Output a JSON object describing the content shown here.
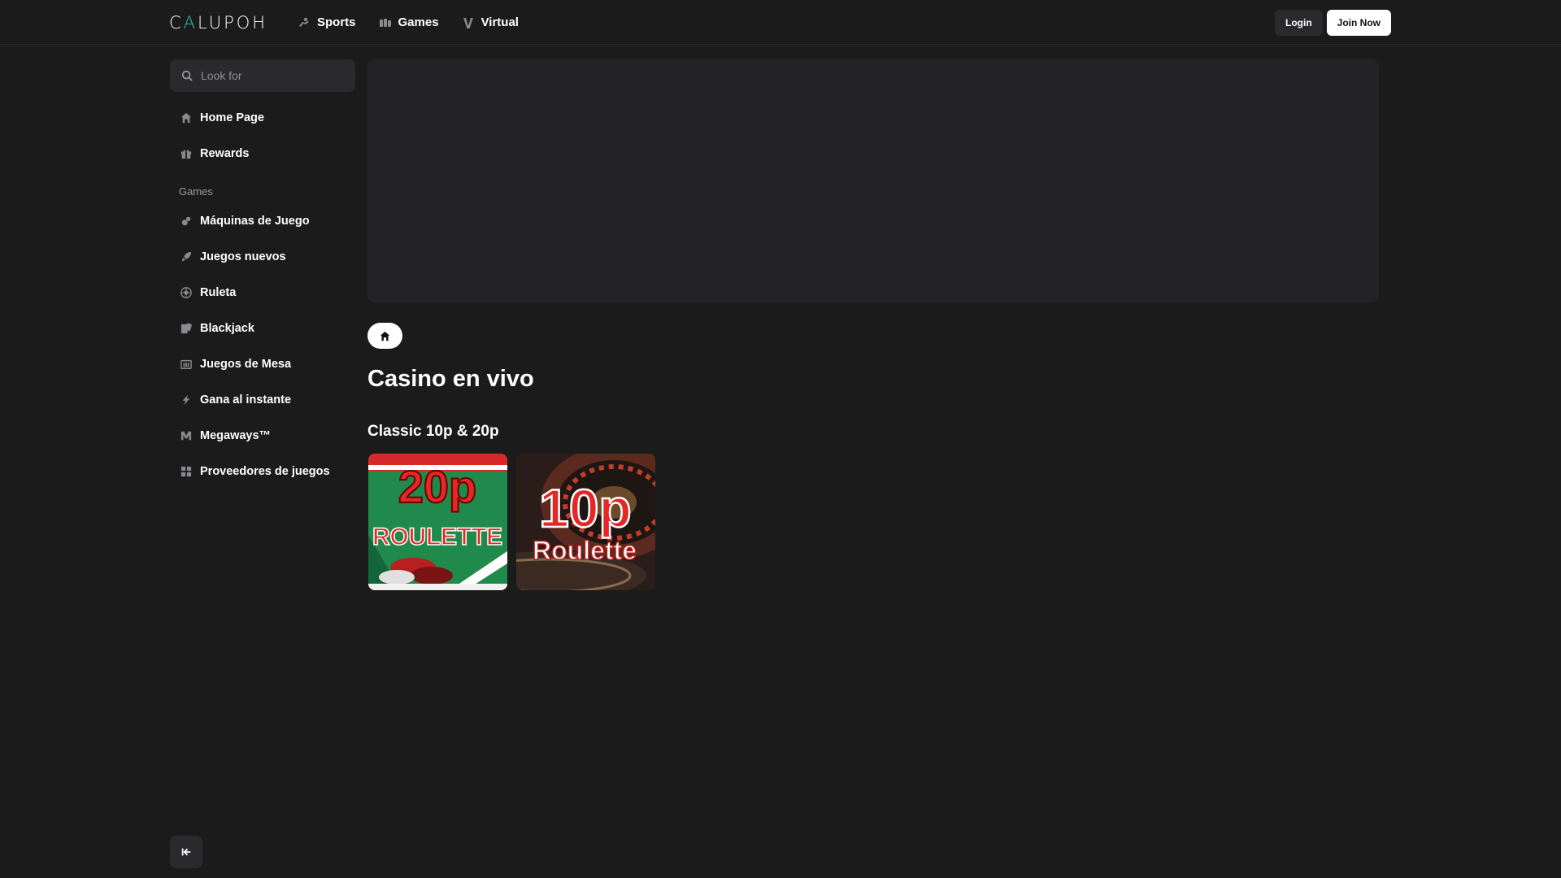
{
  "header": {
    "logo_text_a": "C",
    "logo_text_accent": "A",
    "logo_text_b": "LUPOH",
    "nav": [
      {
        "label": "Sports",
        "icon": "sports-icon"
      },
      {
        "label": "Games",
        "icon": "games-icon"
      },
      {
        "label": "Virtual",
        "icon": "virtual-icon"
      }
    ],
    "login_label": "Login",
    "join_label": "Join Now"
  },
  "sidebar": {
    "search_placeholder": "Look for",
    "top_items": [
      {
        "label": "Home Page",
        "icon": "home-icon"
      },
      {
        "label": "Rewards",
        "icon": "gift-icon"
      }
    ],
    "games_heading": "Games",
    "game_items": [
      {
        "label": "Máquinas de Juego",
        "icon": "slot-machine-icon"
      },
      {
        "label": "Juegos nuevos",
        "icon": "rocket-icon"
      },
      {
        "label": "Ruleta",
        "icon": "roulette-icon"
      },
      {
        "label": "Blackjack",
        "icon": "cards-icon"
      },
      {
        "label": "Juegos de Mesa",
        "icon": "table-games-icon"
      },
      {
        "label": "Gana al instante",
        "icon": "lightning-icon"
      },
      {
        "label": "Megaways™",
        "icon": "megaways-icon"
      },
      {
        "label": "Proveedores de juegos",
        "icon": "grid-icon"
      }
    ]
  },
  "main": {
    "page_title": "Casino en vivo",
    "section_title": "Classic 10p & 20p",
    "games": [
      {
        "line1": "20p",
        "line2": "ROULETTE"
      },
      {
        "line1": "10p",
        "line2": "Roulette"
      }
    ]
  },
  "colors": {
    "background": "#1b1b1c",
    "surface": "#2a2a2c",
    "accent": "#2ec4b6",
    "tile_green": "#1f8a4c",
    "tile_red": "#d62a2a"
  }
}
